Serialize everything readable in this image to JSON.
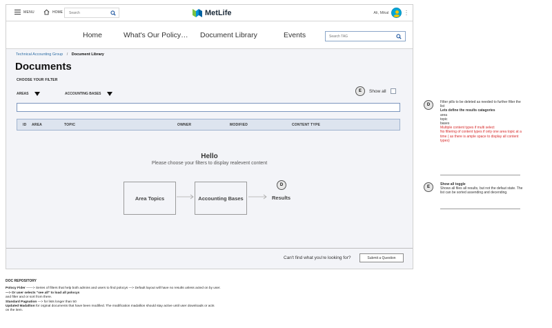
{
  "topbar": {
    "menu_label": "MENU",
    "home_label": "HOME",
    "search_placeholder": "Search",
    "logo_text": "MetLife",
    "user_name": "Ali, Mikal"
  },
  "nav": {
    "items": [
      "Home",
      "What's Our Policy…",
      "Document Library",
      "Events"
    ],
    "search_placeholder": "Search TAG"
  },
  "breadcrumb": {
    "parent": "Technical Accounting Group",
    "separator": "/",
    "current": "Document Library"
  },
  "page": {
    "title": "Documents",
    "filter_heading": "CHOOSE YOUR FILTER",
    "area_dropdown": "AREAS",
    "bases_dropdown": "ACCOUNTING BASES",
    "show_all_label": "Show all",
    "show_all_marker": "E",
    "results_marker": "D"
  },
  "table": {
    "columns": [
      "ID",
      "AREA",
      "TOPIC",
      "OWNER",
      "MODIFIED",
      "CONTENT TYPE"
    ]
  },
  "empty_state": {
    "title": "Hello",
    "subtitle": "Please choose your filters to display realevent content",
    "flow": [
      "Area Topics",
      "Accounting Bases",
      "Results"
    ]
  },
  "footer": {
    "prompt": "Can't find what you're looking for?",
    "button_label": "Submit a Question"
  },
  "repository": {
    "heading": "DOC REPOSITORY",
    "line1_label": "Polocy Fider",
    "line1_text": " ——> Series of filters that help both admins and users to find polocys —> Default layout will have no results unless acted on by user.",
    "line2_label": "—> Or user selects \"see all\" to load all polocys",
    "line3_text": "and filter and or sort from there.",
    "line4_label": "Standard Pagnation",
    "line4_text": " —> for lists longer than 50",
    "line5_label": "Updated Madallion",
    "line5_text": " for orginal documents that have been modified.  The modification madallion should stay active until user downloads or acts",
    "line6_text": "on the item."
  },
  "annotations": {
    "d": {
      "marker": "D",
      "line1": "Filter pills to be deleted as needed to further filter the list",
      "heading": "Lets define the results catagories",
      "items": [
        "area",
        "topic",
        "bases"
      ],
      "red1": "Multiple content types if multi select",
      "red2": "No filtering of content types if only one area topic at a time ( as there is ample space to display all content types)"
    },
    "e": {
      "marker": "E",
      "heading": "Show all toggle",
      "body": "Shows all files all results, but not the defaut state.  The list can be sorted assending and decending."
    }
  },
  "colors": {
    "link": "#2e6da4",
    "content_bg": "#f3f4f8",
    "table_header": "#dde4ef",
    "note_red": "#d62828",
    "logo_green": "#7ac143",
    "logo_blue": "#0090da",
    "avatar_blue": "#00a7d8"
  }
}
